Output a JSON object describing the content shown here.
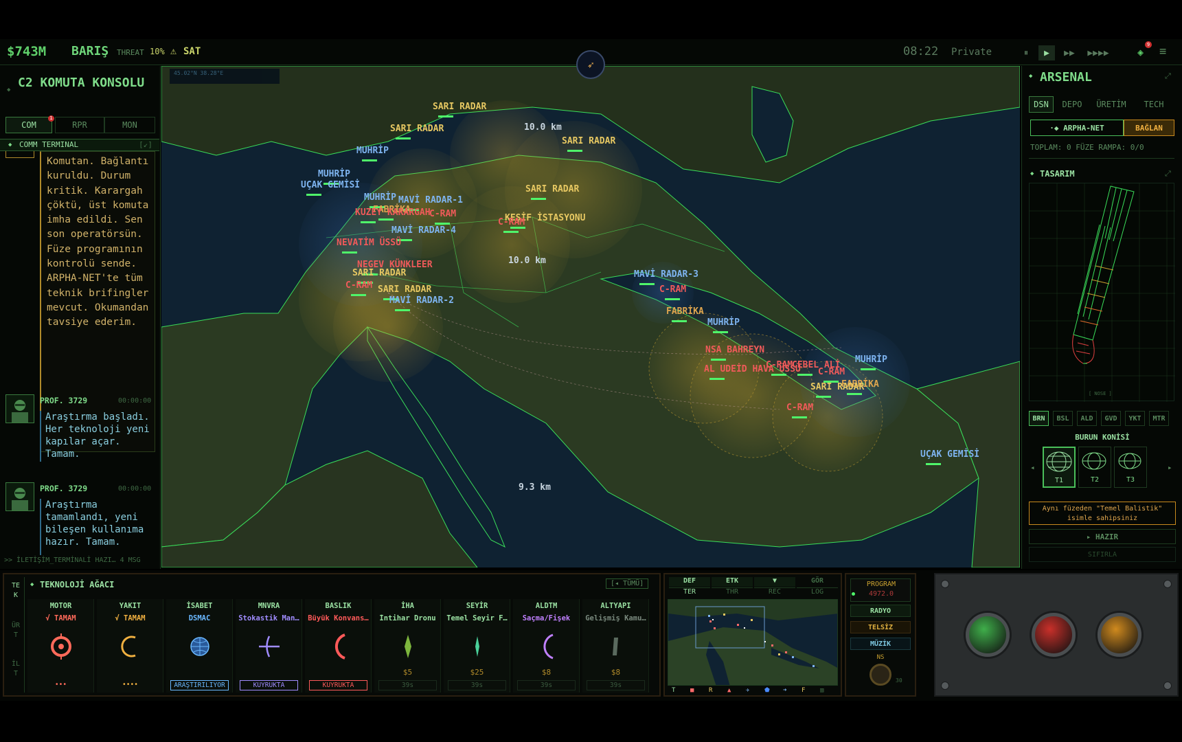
{
  "topbar": {
    "money": "$743M",
    "status": "BARIŞ",
    "threat_label": "THREAT",
    "threat_value": "10%",
    "warning_icon": "⚠",
    "sat": "SAT",
    "clock": "08:22",
    "mode": "Private",
    "speeds": [
      "⏸",
      "▶",
      "▶▶",
      "▶▶▶▶"
    ],
    "notification_count": "9"
  },
  "left_panel": {
    "title": "C2 KOMUTA KONSOLU",
    "tabs": [
      "COM",
      "RPR",
      "MON"
    ],
    "com_badge": "1",
    "comm_header": "COMM TERMINAL",
    "comm_header_icon": "[↙]",
    "first_message": "Komutan. Bağlantı kuruldu. Durum kritik. Karargah çöktü, üst komuta imha edildi. Sen son operatörsün. Füze programının kontrolü sende. ARPHA-NET'te tüm teknik brifingler mevcut. Okumandan tavsiye ederim.",
    "messages": [
      {
        "sender": "PROF. 3729",
        "time": "00:00:00",
        "text": "Araştırma başladı. Her teknoloji yeni kapılar açar. Tamam."
      },
      {
        "sender": "PROF. 3729",
        "time": "00:00:00",
        "text": "Araştırma tamamlandı, yeni bileşen kullanıma hazır. Tamam."
      }
    ],
    "footer": ">> İLETİŞİM_TERMİNALİ HAZI…  4 MSG"
  },
  "map": {
    "coords": "45.02°N 38.28°E",
    "labels": [
      {
        "text": "SARI RADAR",
        "color": "yellow"
      },
      {
        "text": "SARI RADAR",
        "color": "yellow"
      },
      {
        "text": "10.0 km",
        "color": "white"
      },
      {
        "text": "SARI RADAR",
        "color": "yellow"
      },
      {
        "text": "MUHRİP",
        "color": "blue"
      },
      {
        "text": "MUHRİP",
        "color": "blue"
      },
      {
        "text": "UÇAK GEMİSİ",
        "color": "blue"
      },
      {
        "text": "SARI RADAR",
        "color": "yellow"
      },
      {
        "text": "MUHRİP",
        "color": "blue"
      },
      {
        "text": "MAVİ RADAR-1",
        "color": "blue"
      },
      {
        "text": "FABRİKA",
        "color": "orange"
      },
      {
        "text": "KUZEY KARARGAH",
        "color": "red"
      },
      {
        "text": "C-RAM",
        "color": "red"
      },
      {
        "text": "KEŞİF İSTASYONU",
        "color": "yellow"
      },
      {
        "text": "C-RAM",
        "color": "red"
      },
      {
        "text": "MAVİ RADAR-4",
        "color": "blue"
      },
      {
        "text": "NEVATİM ÜSSÜ",
        "color": "red"
      },
      {
        "text": "10.0 km",
        "color": "white"
      },
      {
        "text": "NEGEV KÜNKLEER",
        "color": "red"
      },
      {
        "text": "SARI RADAR",
        "color": "yellow"
      },
      {
        "text": "C-RAM",
        "color": "red"
      },
      {
        "text": "SARI RADAR",
        "color": "yellow"
      },
      {
        "text": "MAVİ RADAR-2",
        "color": "blue"
      },
      {
        "text": "MAVİ RADAR-3",
        "color": "blue"
      },
      {
        "text": "C-RAM",
        "color": "red"
      },
      {
        "text": "FABRİKA",
        "color": "orange"
      },
      {
        "text": "MUHRİP",
        "color": "blue"
      },
      {
        "text": "NSA BAHREYN",
        "color": "red"
      },
      {
        "text": "AL UDEİD HAVA ÜSSÜ",
        "color": "red"
      },
      {
        "text": "C-RAM",
        "color": "red"
      },
      {
        "text": "CEBEL ALİ",
        "color": "red"
      },
      {
        "text": "C-RAM",
        "color": "red"
      },
      {
        "text": "MUHRİP",
        "color": "blue"
      },
      {
        "text": "FABRİKA",
        "color": "orange"
      },
      {
        "text": "SARI RADAR",
        "color": "yellow"
      },
      {
        "text": "C-RAM",
        "color": "red"
      },
      {
        "text": "UÇAK GEMİSİ",
        "color": "blue"
      },
      {
        "text": "9.3 km",
        "color": "white"
      }
    ]
  },
  "right_panel": {
    "title": "ARSENAL",
    "tabs": [
      "DSN",
      "DEPO",
      "ÜRETİM",
      "TECH"
    ],
    "arpha_button": "·◆ ARPHA-NET",
    "connect_button": "BAĞLAN",
    "summary": "TOPLAM: 0 FÜZE RAMPA: 0/0",
    "design_title": "TASARIM",
    "nose_tag": "[ NOSE ]",
    "sections": [
      "BRN",
      "BSL",
      "ALD",
      "GVD",
      "YKT",
      "MTR"
    ],
    "section_title": "BURUN KONİSİ",
    "tiers": [
      "T1",
      "T2",
      "T3"
    ],
    "notice": "Aynı füzeden \"Temel Balistik\" isimle sahipsiniz",
    "ready": "▸ HAZIR",
    "reset": "SIFIRLA"
  },
  "tech_tree": {
    "title": "TEKNOLOJİ AĞACI",
    "all_button": "[◂ TÜMÜ]",
    "side_tabs": [
      "TEK",
      "ÜRT",
      "İLT"
    ],
    "columns": [
      {
        "head": "MOTOR",
        "sub": "√ TAMAM",
        "subcolor": "#ff6a5a",
        "foot": "•••",
        "footcolor": "#ff6a5a",
        "icon": "motor"
      },
      {
        "head": "YAKIT",
        "sub": "√ TAMAM",
        "subcolor": "#f0b040",
        "foot": "••••",
        "footcolor": "#f0b040",
        "icon": "yakit"
      },
      {
        "head": "İSABET",
        "sub": "DSMAC",
        "subcolor": "#6ab8ff",
        "foot": "ARAŞTIRILIYOR",
        "footcolor": "#6ab8ff",
        "icon": "isabet"
      },
      {
        "head": "MNVRA",
        "sub": "Stokastik Man…",
        "subcolor": "#a08cff",
        "foot": "KUYRUKTA",
        "footcolor": "#a08cff",
        "icon": "mnvra"
      },
      {
        "head": "BASLIK",
        "sub": "Büyük Konvans…",
        "subcolor": "#ff5a5a",
        "foot": "KUYRUKTA",
        "footcolor": "#ff5a5a",
        "icon": "baslik"
      },
      {
        "head": "İHA",
        "sub": "İntihar Dronu",
        "subcolor": "#9ae0a2",
        "price": "$5",
        "foot": "39s",
        "footcolor": "#3a5a3e",
        "icon": "iha"
      },
      {
        "head": "SEYİR",
        "sub": "Temel Seyir F…",
        "subcolor": "#9ae0a2",
        "price": "$25",
        "foot": "39s",
        "footcolor": "#3a5a3e",
        "icon": "seyir"
      },
      {
        "head": "ALDTM",
        "sub": "Saçma/Fişek",
        "subcolor": "#c080ff",
        "price": "$8",
        "foot": "39s",
        "footcolor": "#3a5a3e",
        "icon": "aldtm"
      },
      {
        "head": "ALTYAPI",
        "sub": "Gelişmiş Kamu…",
        "subcolor": "#7a8a7e",
        "price": "$8",
        "foot": "39s",
        "footcolor": "#3a5a3e",
        "icon": "altyapi"
      }
    ]
  },
  "minimap": {
    "tabs_top": [
      "DEF",
      "ETK",
      "▼",
      "GÖR"
    ],
    "tabs_bottom": [
      "TER",
      "THR",
      "REC",
      "LOG"
    ],
    "legend": [
      "T",
      "■",
      "R",
      "▲",
      "✈",
      "⬟",
      "➜",
      "F",
      "▥"
    ]
  },
  "radio": {
    "program_label": "PROGRAM",
    "program_value": "4972.0",
    "buttons": [
      "RADYO",
      "TELSİZ",
      "MÜZİK"
    ],
    "dial_label": "NS",
    "dial_value": "30"
  },
  "launch_buttons": {
    "colors": [
      "#3fae4a",
      "#c9302a",
      "#d08a1e"
    ]
  }
}
